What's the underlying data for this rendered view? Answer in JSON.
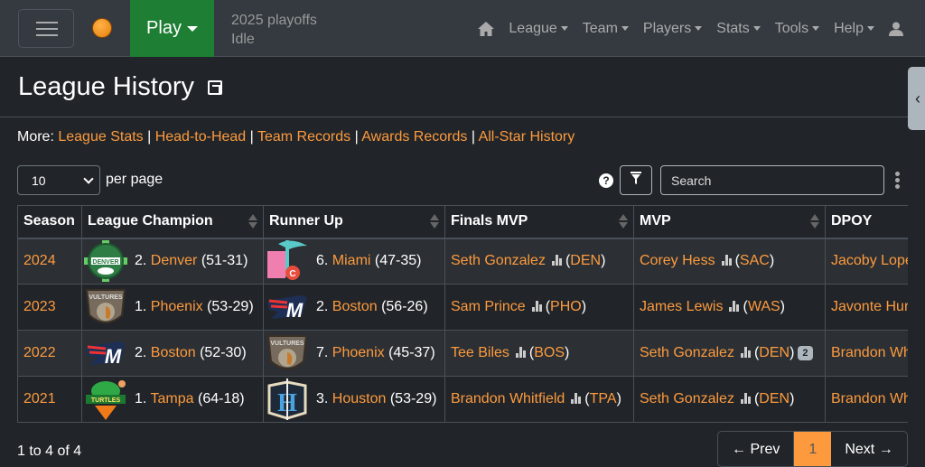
{
  "nav": {
    "play": "Play",
    "phase": "2025 playoffs",
    "status": "Idle",
    "menu": [
      "League",
      "Team",
      "Players",
      "Stats",
      "Tools",
      "Help"
    ]
  },
  "title": "League History",
  "more": {
    "label": "More:",
    "links": [
      "League Stats",
      "Head-to-Head",
      "Team Records",
      "Awards Records",
      "All-Star History"
    ]
  },
  "controls": {
    "per_page_value": "10",
    "per_page_label": "per page",
    "search_placeholder": "Search",
    "help": "?"
  },
  "table": {
    "headers": [
      "Season",
      "League Champion",
      "Runner Up",
      "Finals MVP",
      "MVP",
      "DPOY"
    ],
    "rows": [
      {
        "season": "2024",
        "champ_seed": "2.",
        "champ": "Denver",
        "champ_rec": "(51-31)",
        "champ_logo": "denver",
        "ru_seed": "6.",
        "ru": "Miami",
        "ru_rec": "(47-35)",
        "ru_logo": "miami",
        "fmvp": "Seth Gonzalez",
        "fmvp_team": "DEN",
        "mvp": "Corey Hess",
        "mvp_team": "SAC",
        "mvp_badge": "",
        "dpoy": "Jacoby Lope"
      },
      {
        "season": "2023",
        "champ_seed": "1.",
        "champ": "Phoenix",
        "champ_rec": "(53-29)",
        "champ_logo": "phoenix",
        "ru_seed": "2.",
        "ru": "Boston",
        "ru_rec": "(56-26)",
        "ru_logo": "boston",
        "fmvp": "Sam Prince",
        "fmvp_team": "PHO",
        "mvp": "James Lewis",
        "mvp_team": "WAS",
        "mvp_badge": "",
        "dpoy": "Javonte Hur"
      },
      {
        "season": "2022",
        "champ_seed": "2.",
        "champ": "Boston",
        "champ_rec": "(52-30)",
        "champ_logo": "boston",
        "ru_seed": "7.",
        "ru": "Phoenix",
        "ru_rec": "(45-37)",
        "ru_logo": "phoenix",
        "fmvp": "Tee Biles",
        "fmvp_team": "BOS",
        "mvp": "Seth Gonzalez",
        "mvp_team": "DEN",
        "mvp_badge": "2",
        "dpoy": "Brandon Wh"
      },
      {
        "season": "2021",
        "champ_seed": "1.",
        "champ": "Tampa",
        "champ_rec": "(64-18)",
        "champ_logo": "tampa",
        "ru_seed": "3.",
        "ru": "Houston",
        "ru_rec": "(53-29)",
        "ru_logo": "houston",
        "fmvp": "Brandon Whitfield",
        "fmvp_team": "TPA",
        "mvp": "Seth Gonzalez",
        "mvp_team": "DEN",
        "mvp_badge": "",
        "dpoy": "Brandon Wh"
      }
    ]
  },
  "logo_text": {
    "denver": "DENVER",
    "phoenix": "VULTURES",
    "boston": "M",
    "tampa": "TURTLES",
    "houston": "H",
    "miami": "C"
  },
  "footer": {
    "summary": "1 to 4 of 4",
    "prev": "← Prev",
    "page": "1",
    "next": "Next →"
  },
  "colors": {
    "link": "#fd9a3e",
    "play": "#1e7e34",
    "navbar": "#343a40",
    "background": "#212529"
  }
}
